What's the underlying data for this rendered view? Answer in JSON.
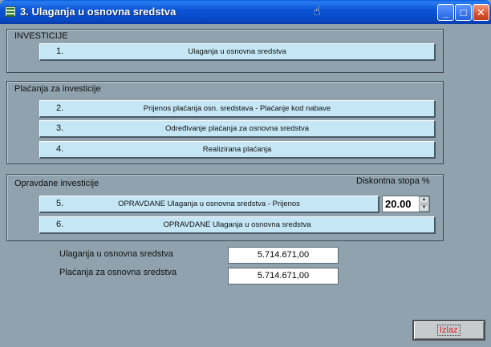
{
  "window": {
    "title": "3. Ulaganja u osnovna sredstva",
    "controls": {
      "minimize": "_",
      "maximize": "□",
      "close": "✕"
    }
  },
  "sections": {
    "investicije": {
      "label": "INVESTICIJE",
      "buttons": [
        {
          "num": "1.",
          "label": "Ulaganja u osnovna sredstva"
        }
      ]
    },
    "placanja": {
      "label": "Plaćanja za investicije",
      "buttons": [
        {
          "num": "2.",
          "label": "Prijenos plaćanja osn. sredstava - Plaćanje kod nabave"
        },
        {
          "num": "3.",
          "label": "Određivanje plaćanja za osnovna sredstva"
        },
        {
          "num": "4.",
          "label": "Realizirana  plaćanja"
        }
      ]
    },
    "opravdane": {
      "label": "Opravdane  investicije",
      "discount_label": "Diskontna stopa %",
      "discount_value": "20.00",
      "buttons": [
        {
          "num": "5.",
          "label": "OPRAVDANE  Ulaganja u osnovna sredstva  - Prijenos"
        },
        {
          "num": "6.",
          "label": "OPRAVDANE  Ulaganja u osnovna sredstva"
        }
      ]
    }
  },
  "summary": {
    "ulaganja_label": "Ulaganja u osnovna sredstva",
    "ulaganja_value": "5.714.671,00",
    "placanja_label": "Plaćanja za osnovna sredstva",
    "placanja_value": "5.714.671,00"
  },
  "exit_button": {
    "label": "Izlaz"
  },
  "colors": {
    "background": "#8fa2ad",
    "button": "#c4e6f5",
    "titlebar": "#0b55d6",
    "exit_text": "#dd2222"
  }
}
